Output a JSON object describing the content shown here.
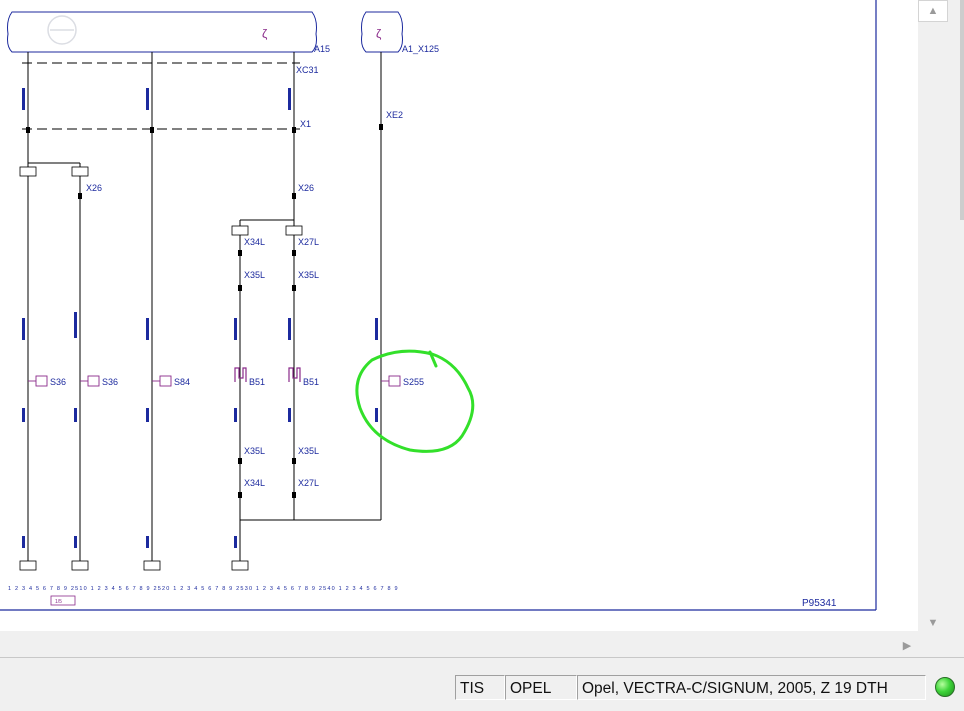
{
  "diagram": {
    "modules": [
      {
        "label": "A15",
        "connector": "XC31"
      },
      {
        "label": "A1_X125"
      }
    ],
    "connectors": [
      "X1",
      "X26",
      "X26",
      "X34L",
      "X27L",
      "X35L",
      "X35L",
      "X35L",
      "X35L",
      "X34L",
      "X27L",
      "XE2"
    ],
    "switches": [
      "S36",
      "S36",
      "S84",
      "S255"
    ],
    "sensors": [
      "B51",
      "B51"
    ],
    "ruler_tag": "1/5",
    "page_ref": "P95341",
    "ruler_numbers": "1 2 3 4 5 6 7 8 9 2510 1 2 3 4 5 6 7 8 9 2520 1 2 3 4 5 6 7 8 9 2530 1 2 3 4 5 6 7 8 9 2540 1 2 3 4 5 6 7 8 9",
    "highlight_color": "#33e02a",
    "wire_color": "#000000",
    "text_color": "#1c2a9e"
  },
  "scrollbars": {
    "up_arrow": "▲",
    "down_arrow": "▼",
    "right_arrow": "▶"
  },
  "statusbar": {
    "tis": "TIS",
    "brand": "OPEL",
    "vehicle": "Opel, VECTRA-C/SIGNUM, 2005, Z 19 DTH",
    "connection_status_color": "#3ed43a"
  }
}
